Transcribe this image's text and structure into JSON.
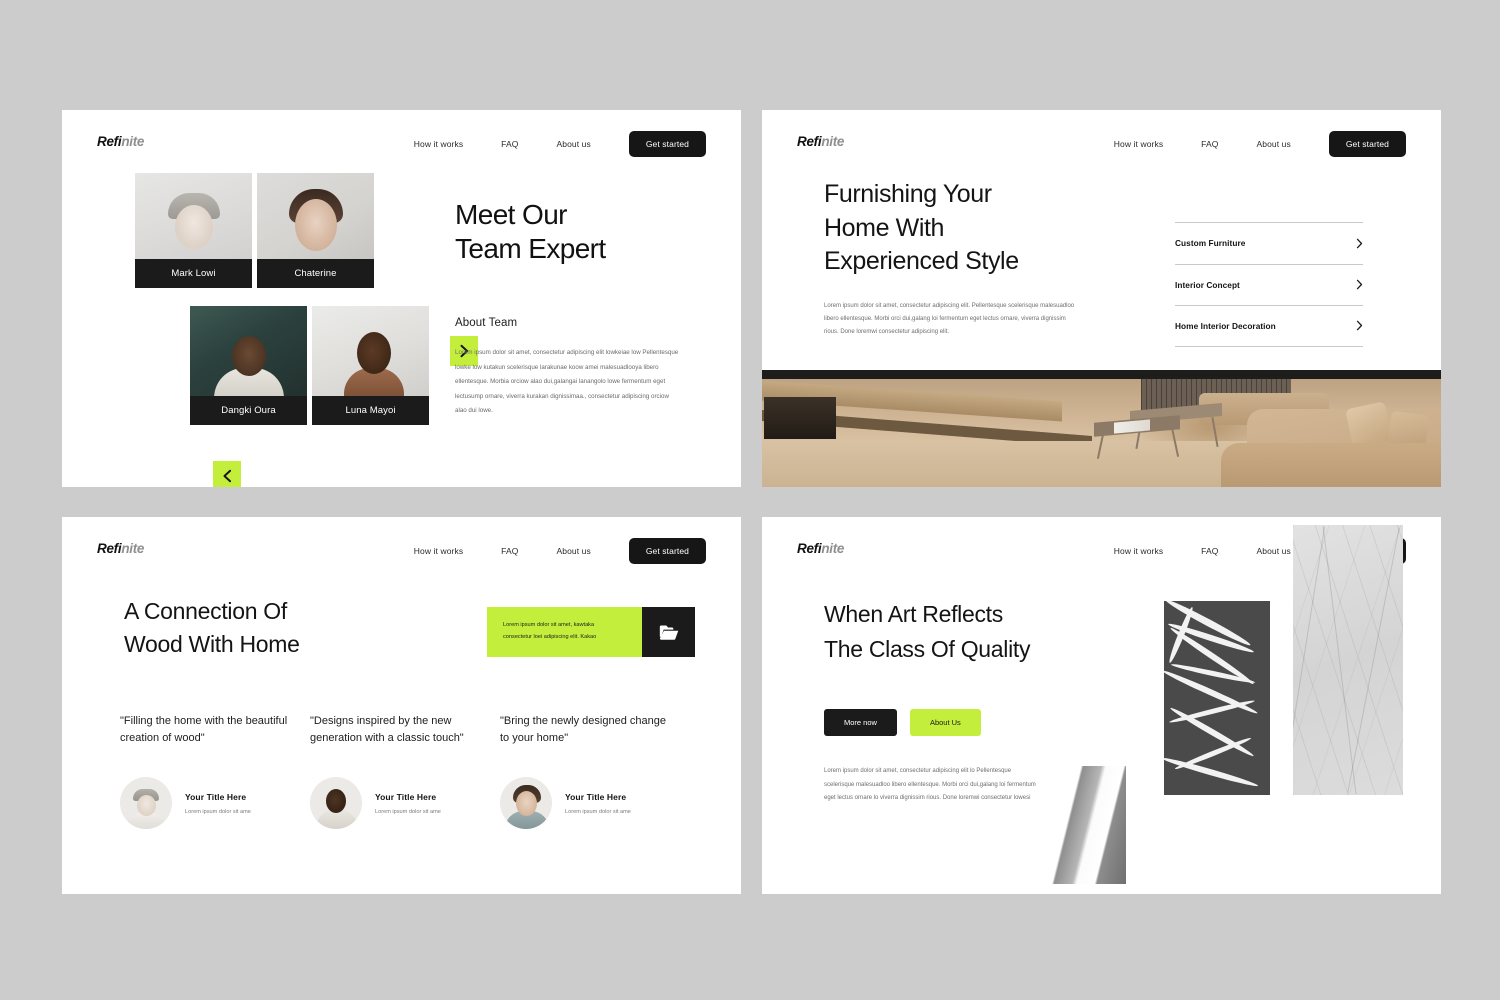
{
  "background_color": "#cccccc",
  "brand": {
    "accent_green": "#c3ef3c",
    "dark": "#1b1b1b",
    "logo_part1": "Refi",
    "logo_part2": "nite"
  },
  "nav": {
    "links": [
      "How it works",
      "FAQ",
      "About us"
    ],
    "cta_label": "Get started"
  },
  "slides": [
    {
      "id": "slide-1",
      "title_line1": "Meet Our",
      "title_line2": "Team Expert",
      "subtitle": "About Team",
      "body": "Lorem ipsum dolor sit amet, consectetur adipiscing elit lowkeiae low Pellentesque lowke low kutakun scelerisque larakunae koow amei malesuadlooya libero ellentesque. Morbia orciow alao dui,galangai lanangolo lowe fermentum eget lectusump ornare, viverra kurakan dignissimaa., consectetur adipiscing orciow alao dui lowe.",
      "team": [
        {
          "name": "Mark Lowi"
        },
        {
          "name": "Chaterine"
        },
        {
          "name": "Dangki Oura"
        },
        {
          "name": "Luna Mayoi"
        }
      ],
      "carousel": {
        "next_icon": "chevron-right-icon",
        "prev_icon": "chevron-left-icon"
      }
    },
    {
      "id": "slide-2",
      "title_line1": "Furnishing Your",
      "title_line2": "Home With",
      "title_line3": "Experienced Style",
      "body": "Lorem ipsum dolor sit amet, consectetur adipiscing elit. Pellentesque scelerisque malesuadloo libero ellentesque. Morbi orci dui,galang loi fermentum eget lectus ornare, viverra dignissim rious. Done loremwi consectetur adipiscing elit.",
      "accordion": [
        {
          "label": "Custom Furniture"
        },
        {
          "label": "Interior Concept"
        },
        {
          "label": "Home Interior Decoration"
        }
      ]
    },
    {
      "id": "slide-3",
      "title_line1": "A Connection Of",
      "title_line2": "Wood With Home",
      "callout_text_line1": "Lorem ipsum dolor sit amet, kawtaka",
      "callout_text_line2": "consectetur loei adipiscing elit. Kakao",
      "callout_icon": "folder-icon",
      "quotes": [
        {
          "text": "\"Filling the home with the beautiful creation of wood\"",
          "person_title": "Your Title Here",
          "person_sub": "Lorem ipsum dolor sit ame"
        },
        {
          "text": "\"Designs inspired by the new generation with a classic touch\"",
          "person_title": "Your Title Here",
          "person_sub": "Lorem ipsum dolor sit ame"
        },
        {
          "text": "\"Bring the newly designed change to your home\"",
          "person_title": "Your Title Here",
          "person_sub": "Lorem ipsum dolor sit ame"
        }
      ]
    },
    {
      "id": "slide-4",
      "title_line1": "When Art Reflects",
      "title_line2": "The Class Of Quality",
      "primary_button": "More now",
      "secondary_button": "About Us",
      "body": "Lorem ipsum dolor sit amet, consectetur adipiscing elit lo Pellentesque scelerisque malesuadloo libero ellentesque. Morbi orci dui,galang loi fermentum eget lectus ornare lo viverra dignissim rious. Done loremwi consectetur lowesi",
      "panels": [
        "abstract-curve-image",
        "palm-shadow-image",
        "marble-texture-image"
      ]
    }
  ]
}
